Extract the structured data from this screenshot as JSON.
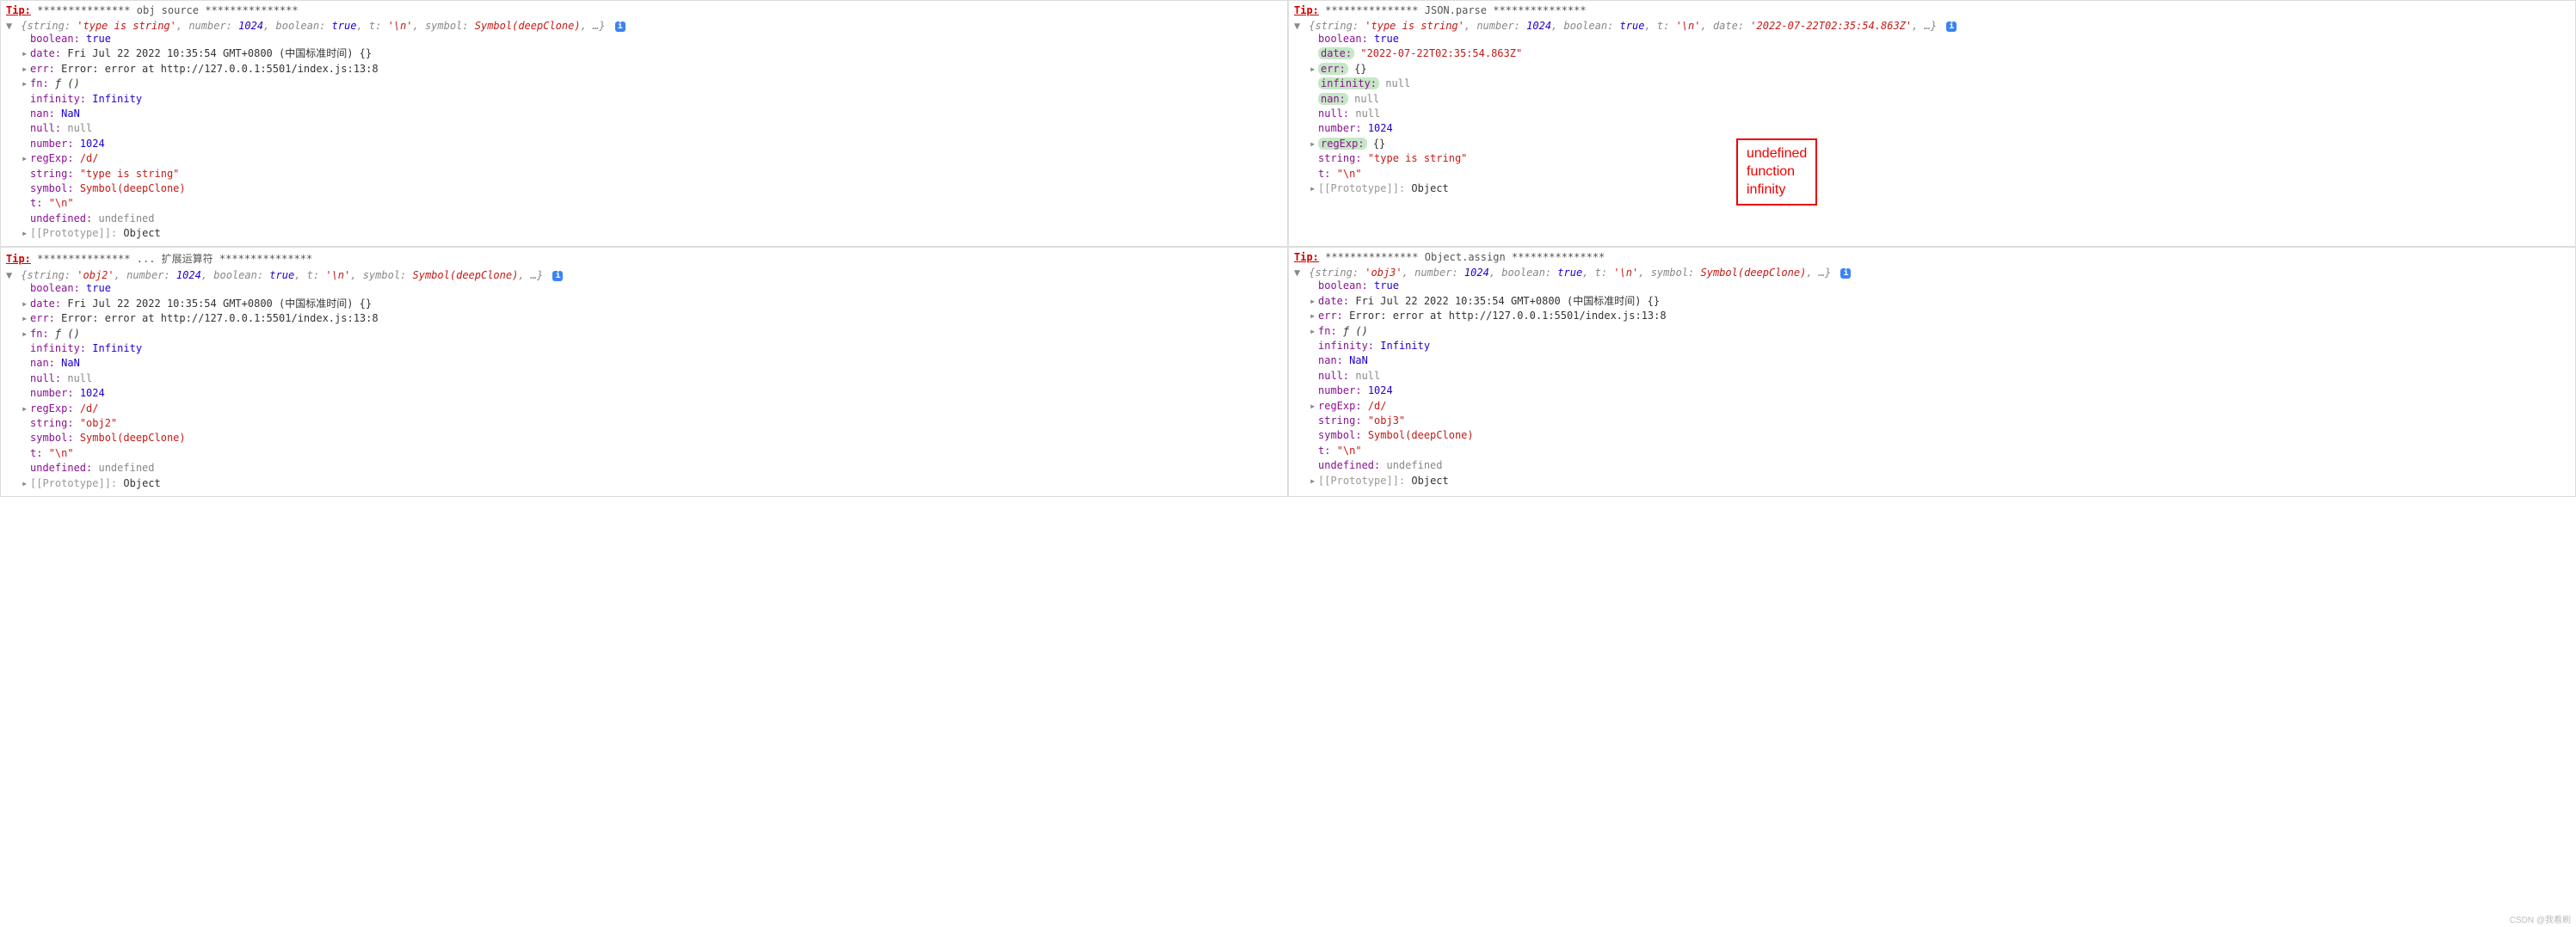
{
  "watermark": "CSDN @我看刷",
  "panels": {
    "p1": {
      "tip_label": "Tip:",
      "tip_stars": "***************",
      "tip_text": "obj source",
      "summary": {
        "string_k": "string:",
        "string_v": "'type is string'",
        "number_k": "number:",
        "number_v": "1024",
        "boolean_k": "boolean:",
        "boolean_v": "true",
        "t_k": "t:",
        "t_v": "'\\n'",
        "symbol_k": "symbol:",
        "symbol_v": "Symbol(deepClone)",
        "tail": ", …}"
      },
      "props": {
        "boolean": {
          "k": "boolean:",
          "v": "true",
          "cls": "val-bool"
        },
        "date": {
          "k": "date:",
          "v": "Fri Jul 22 2022 10:35:54 GMT+0800 (中国标准时间) {}",
          "cls": "val-date",
          "caret": true
        },
        "err": {
          "k": "err:",
          "v": "Error: error at http://127.0.0.1:5501/index.js:13:8",
          "cls": "val-err",
          "caret": true
        },
        "fn": {
          "k": "fn:",
          "v": "ƒ ()",
          "cls": "val-fn",
          "caret": true
        },
        "infinity": {
          "k": "infinity:",
          "v": "Infinity",
          "cls": "val-inf"
        },
        "nan": {
          "k": "nan:",
          "v": "NaN",
          "cls": "val-nan"
        },
        "null": {
          "k": "null:",
          "v": "null",
          "cls": "val-null"
        },
        "number": {
          "k": "number:",
          "v": "1024",
          "cls": "val-num"
        },
        "regExp": {
          "k": "regExp:",
          "v": "/d/",
          "cls": "val-regex",
          "caret": true
        },
        "string": {
          "k": "string:",
          "v": "\"type is string\"",
          "cls": "val-str"
        },
        "symbol": {
          "k": "symbol:",
          "v": "Symbol(deepClone)",
          "cls": "val-sym"
        },
        "t": {
          "k": "t:",
          "v": "\"\\n\"",
          "cls": "val-str"
        },
        "undefined": {
          "k": "undefined:",
          "v": "undefined",
          "cls": "val-undef"
        },
        "proto": {
          "k": "[[Prototype]]:",
          "v": "Object",
          "cls": "val-obj",
          "caret": true,
          "dim": true
        }
      }
    },
    "p2": {
      "tip_label": "Tip:",
      "tip_stars": "***************",
      "tip_text": "JSON.parse",
      "summary": {
        "string_k": "string:",
        "string_v": "'type is string'",
        "number_k": "number:",
        "number_v": "1024",
        "boolean_k": "boolean:",
        "boolean_v": "true",
        "t_k": "t:",
        "t_v": "'\\n'",
        "date_k": "date:",
        "date_v": "'2022-07-22T02:35:54.863Z'",
        "tail": ", …}"
      },
      "props": {
        "boolean": {
          "k": "boolean:",
          "v": "true",
          "cls": "val-bool"
        },
        "date": {
          "k": "date:",
          "v": "\"2022-07-22T02:35:54.863Z\"",
          "cls": "val-str",
          "hl": true
        },
        "err": {
          "k": "err:",
          "v": "{}",
          "cls": "val-obj",
          "caret": true,
          "hl": true
        },
        "infinity": {
          "k": "infinity:",
          "v": "null",
          "cls": "val-null",
          "hl": true
        },
        "nan": {
          "k": "nan:",
          "v": "null",
          "cls": "val-null",
          "hl": true
        },
        "null": {
          "k": "null:",
          "v": "null",
          "cls": "val-null"
        },
        "number": {
          "k": "number:",
          "v": "1024",
          "cls": "val-num"
        },
        "regExp": {
          "k": "regExp:",
          "v": "{}",
          "cls": "val-obj",
          "caret": true,
          "hl": true
        },
        "string": {
          "k": "string:",
          "v": "\"type is string\"",
          "cls": "val-str"
        },
        "t": {
          "k": "t:",
          "v": "\"\\n\"",
          "cls": "val-str"
        },
        "proto": {
          "k": "[[Prototype]]:",
          "v": "Object",
          "cls": "val-obj",
          "caret": true,
          "dim": true
        }
      },
      "callout": [
        "undefined",
        "function",
        "infinity"
      ]
    },
    "p3": {
      "tip_label": "Tip:",
      "tip_stars": "***************",
      "tip_text": "... 扩展运算符",
      "summary": {
        "string_k": "string:",
        "string_v": "'obj2'",
        "number_k": "number:",
        "number_v": "1024",
        "boolean_k": "boolean:",
        "boolean_v": "true",
        "t_k": "t:",
        "t_v": "'\\n'",
        "symbol_k": "symbol:",
        "symbol_v": "Symbol(deepClone)",
        "tail": ", …}"
      },
      "props": {
        "boolean": {
          "k": "boolean:",
          "v": "true",
          "cls": "val-bool"
        },
        "date": {
          "k": "date:",
          "v": "Fri Jul 22 2022 10:35:54 GMT+0800 (中国标准时间) {}",
          "cls": "val-date",
          "caret": true
        },
        "err": {
          "k": "err:",
          "v": "Error: error at http://127.0.0.1:5501/index.js:13:8",
          "cls": "val-err",
          "caret": true
        },
        "fn": {
          "k": "fn:",
          "v": "ƒ ()",
          "cls": "val-fn",
          "caret": true
        },
        "infinity": {
          "k": "infinity:",
          "v": "Infinity",
          "cls": "val-inf"
        },
        "nan": {
          "k": "nan:",
          "v": "NaN",
          "cls": "val-nan"
        },
        "null": {
          "k": "null:",
          "v": "null",
          "cls": "val-null"
        },
        "number": {
          "k": "number:",
          "v": "1024",
          "cls": "val-num"
        },
        "regExp": {
          "k": "regExp:",
          "v": "/d/",
          "cls": "val-regex",
          "caret": true
        },
        "string": {
          "k": "string:",
          "v": "\"obj2\"",
          "cls": "val-str"
        },
        "symbol": {
          "k": "symbol:",
          "v": "Symbol(deepClone)",
          "cls": "val-sym"
        },
        "t": {
          "k": "t:",
          "v": "\"\\n\"",
          "cls": "val-str"
        },
        "undefined": {
          "k": "undefined:",
          "v": "undefined",
          "cls": "val-undef"
        },
        "proto": {
          "k": "[[Prototype]]:",
          "v": "Object",
          "cls": "val-obj",
          "caret": true,
          "dim": true
        }
      }
    },
    "p4": {
      "tip_label": "Tip:",
      "tip_stars": "***************",
      "tip_text": "Object.assign",
      "summary": {
        "string_k": "string:",
        "string_v": "'obj3'",
        "number_k": "number:",
        "number_v": "1024",
        "boolean_k": "boolean:",
        "boolean_v": "true",
        "t_k": "t:",
        "t_v": "'\\n'",
        "symbol_k": "symbol:",
        "symbol_v": "Symbol(deepClone)",
        "tail": ", …}"
      },
      "props": {
        "boolean": {
          "k": "boolean:",
          "v": "true",
          "cls": "val-bool"
        },
        "date": {
          "k": "date:",
          "v": "Fri Jul 22 2022 10:35:54 GMT+0800 (中国标准时间) {}",
          "cls": "val-date",
          "caret": true
        },
        "err": {
          "k": "err:",
          "v": "Error: error at http://127.0.0.1:5501/index.js:13:8",
          "cls": "val-err",
          "caret": true
        },
        "fn": {
          "k": "fn:",
          "v": "ƒ ()",
          "cls": "val-fn",
          "caret": true
        },
        "infinity": {
          "k": "infinity:",
          "v": "Infinity",
          "cls": "val-inf"
        },
        "nan": {
          "k": "nan:",
          "v": "NaN",
          "cls": "val-nan"
        },
        "null": {
          "k": "null:",
          "v": "null",
          "cls": "val-null"
        },
        "number": {
          "k": "number:",
          "v": "1024",
          "cls": "val-num"
        },
        "regExp": {
          "k": "regExp:",
          "v": "/d/",
          "cls": "val-regex",
          "caret": true
        },
        "string": {
          "k": "string:",
          "v": "\"obj3\"",
          "cls": "val-str"
        },
        "symbol": {
          "k": "symbol:",
          "v": "Symbol(deepClone)",
          "cls": "val-sym"
        },
        "t": {
          "k": "t:",
          "v": "\"\\n\"",
          "cls": "val-str"
        },
        "undefined": {
          "k": "undefined:",
          "v": "undefined",
          "cls": "val-undef"
        },
        "proto": {
          "k": "[[Prototype]]:",
          "v": "Object",
          "cls": "val-obj",
          "caret": true,
          "dim": true
        }
      }
    }
  }
}
